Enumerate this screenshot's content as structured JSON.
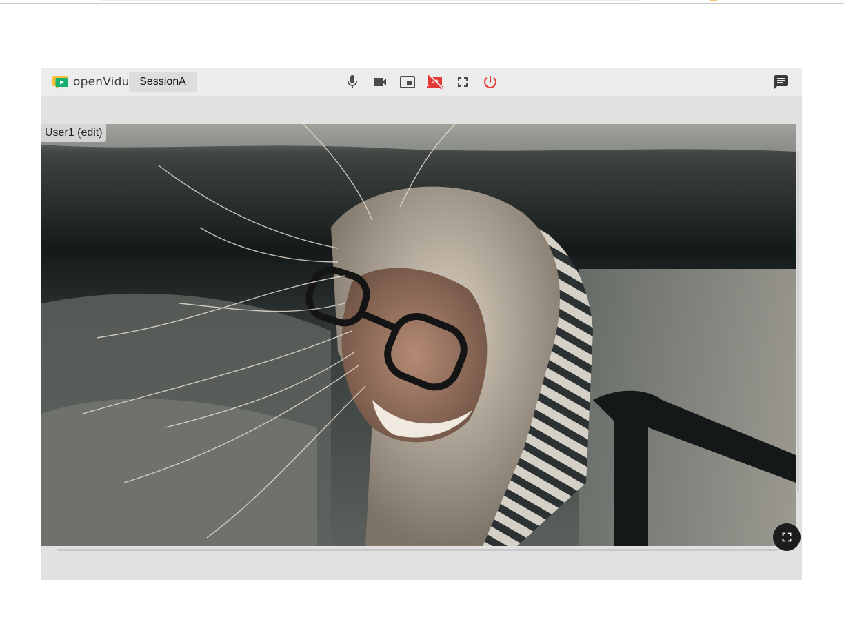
{
  "header": {
    "brand": "openVidu",
    "session_name": "SessionA"
  },
  "toolbar": {
    "buttons": [
      {
        "name": "microphone",
        "icon": "mic-icon",
        "color": "#4a4a4a"
      },
      {
        "name": "camera",
        "icon": "videocam-icon",
        "color": "#4a4a4a"
      },
      {
        "name": "screen-share",
        "icon": "picture-in-picture-icon",
        "color": "#4a4a4a"
      },
      {
        "name": "stop-screen-share",
        "icon": "stop-screen-share-icon",
        "color": "#e53935"
      },
      {
        "name": "fullscreen",
        "icon": "fullscreen-icon",
        "color": "#4a4a4a"
      },
      {
        "name": "leave-session",
        "icon": "power-icon",
        "color": "#e53935"
      }
    ],
    "chat_icon": "chat-icon"
  },
  "stream": {
    "nickname": "User1 (edit)",
    "fullscreen_icon": "fullscreen-icon"
  },
  "colors": {
    "accent_red": "#e53935",
    "toolbar_bg": "#ececec",
    "app_bg": "#e1e1e1"
  }
}
